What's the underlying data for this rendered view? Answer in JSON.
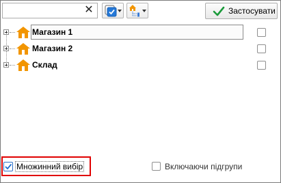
{
  "toolbar": {
    "search": {
      "value": "",
      "placeholder": "",
      "clear_glyph": "✕"
    },
    "check_button_icon": "checkbox-checked-icon",
    "structure_button_icon": "hierarchy-icon",
    "apply_label": "Застосувати",
    "apply_icon": "checkmark-icon"
  },
  "tree": {
    "items": [
      {
        "label": "Магазин 1",
        "icon": "house-icon",
        "selected": true,
        "checked": false
      },
      {
        "label": "Магазин 2",
        "icon": "house-icon",
        "selected": false,
        "checked": false
      },
      {
        "label": "Склад",
        "icon": "house-icon",
        "selected": false,
        "checked": false
      }
    ]
  },
  "footer": {
    "multi_select_label": "Множинний вибір",
    "multi_select_checked": true,
    "include_subgroups_label": "Включаючи підгрупи",
    "include_subgroups_checked": false
  },
  "colors": {
    "house": "#f29500",
    "check_blue": "#1f6fd0",
    "apply_check": "#1a9a3a",
    "highlight": "#e00000"
  }
}
